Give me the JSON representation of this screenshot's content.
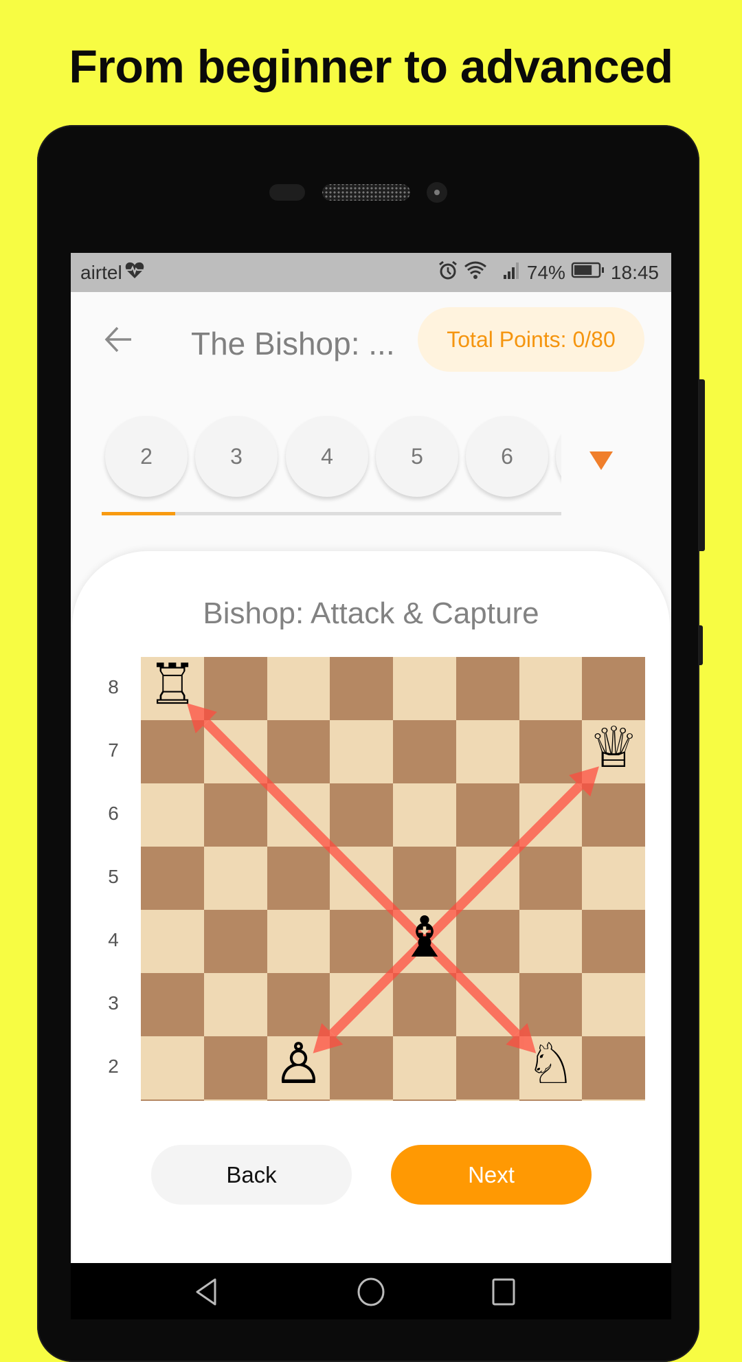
{
  "promo": {
    "headline": "From beginner to advanced",
    "background_color": "#F7FC43"
  },
  "status_bar": {
    "carrier": "airtel",
    "carrier_badge_icon": "heart-pulse-icon",
    "icons": [
      "alarm-icon",
      "wifi-icon",
      "signal-icon"
    ],
    "battery_percent": "74%",
    "battery_level": 0.74,
    "time": "18:45"
  },
  "app_bar": {
    "back_icon": "arrow-left-icon",
    "title": "The Bishop: ...",
    "points_label": "Total Points: 0/80",
    "accent_color": "#F5950F"
  },
  "steps": {
    "items": [
      {
        "label": "2"
      },
      {
        "label": "3"
      },
      {
        "label": "4"
      },
      {
        "label": "5"
      },
      {
        "label": "6"
      }
    ],
    "dropdown_icon": "triangle-down-icon",
    "progress_fraction": 0.16
  },
  "lesson": {
    "title": "Bishop: Attack & Capture",
    "ranks": [
      "8",
      "7",
      "6",
      "5",
      "4",
      "3",
      "2"
    ],
    "board_colors": {
      "light": "#EFD9B4",
      "dark": "#B58863"
    },
    "pieces": [
      {
        "name": "white-rook",
        "glyph": "♖",
        "square": "a8"
      },
      {
        "name": "white-queen",
        "glyph": "♕",
        "square": "h7"
      },
      {
        "name": "black-bishop",
        "glyph": "♝",
        "square": "e4"
      },
      {
        "name": "white-pawn",
        "glyph": "♙",
        "square": "c2"
      },
      {
        "name": "white-knight",
        "glyph": "♘",
        "square": "g2"
      }
    ],
    "arrows": [
      {
        "from": "e4",
        "to": "a8"
      },
      {
        "from": "e4",
        "to": "h7"
      },
      {
        "from": "e4",
        "to": "c2"
      },
      {
        "from": "e4",
        "to": "g2"
      }
    ],
    "arrow_color": "#FF4B3E"
  },
  "buttons": {
    "back_label": "Back",
    "next_label": "Next",
    "next_color": "#FF9903"
  },
  "nav_bar": {
    "icons": [
      "nav-back-icon",
      "nav-home-icon",
      "nav-recents-icon"
    ]
  }
}
